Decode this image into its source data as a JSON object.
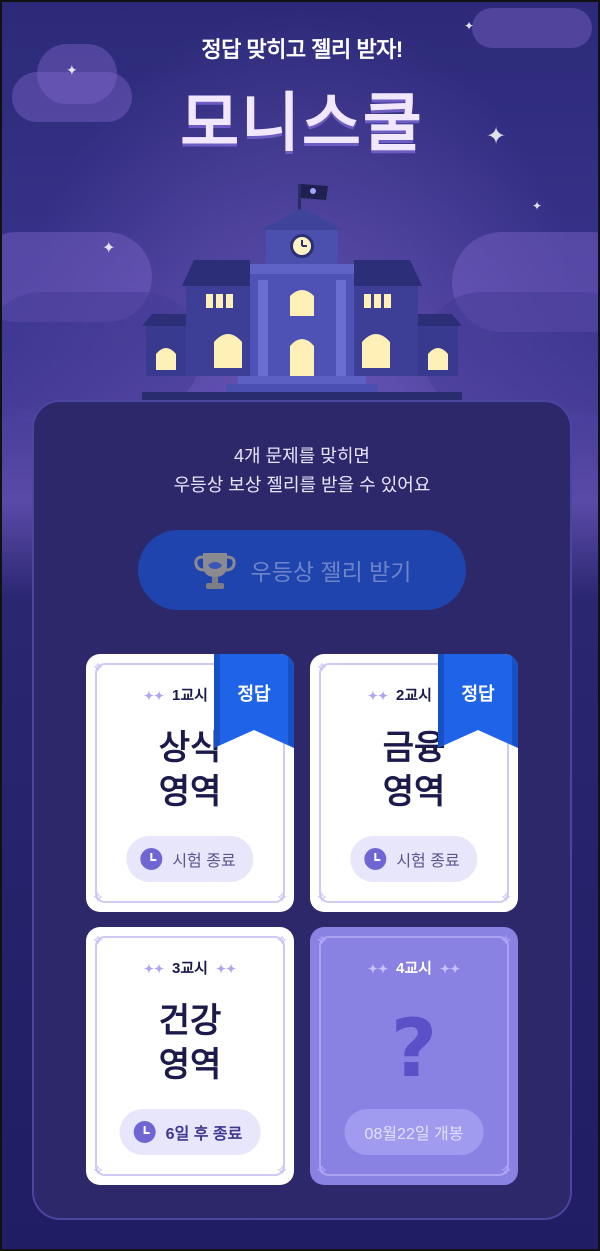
{
  "header": {
    "subtitle": "정답 맞히고 젤리 받자!",
    "title": "모니스쿨"
  },
  "main": {
    "description_line1": "4개 문제를 맞히면",
    "description_line2": "우등상 보상 젤리를 받을 수 있어요",
    "cta_label": "우등상 젤리 받기",
    "cta_icon": "trophy-icon"
  },
  "cards": [
    {
      "period": "1교시",
      "subject_line1": "상식",
      "subject_line2": "영역",
      "status": "시험 종료",
      "badge": "정답"
    },
    {
      "period": "2교시",
      "subject_line1": "금융",
      "subject_line2": "영역",
      "status": "시험 종료",
      "badge": "정답"
    },
    {
      "period": "3교시",
      "subject_line1": "건강",
      "subject_line2": "영역",
      "status": "6일 후 종료"
    },
    {
      "period": "4교시",
      "placeholder": "?",
      "status": "08월22일 개봉"
    }
  ],
  "colors": {
    "background_top": "#2c2a78",
    "panel": "#2d2869",
    "cta": "#1f44ad",
    "badge": "#1f63e8",
    "locked_card": "#8a82e3"
  }
}
